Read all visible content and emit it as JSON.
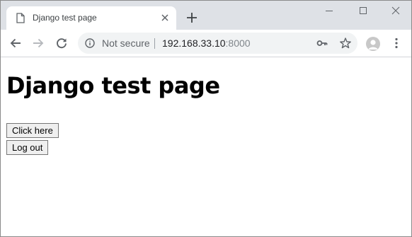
{
  "browser": {
    "tab": {
      "title": "Django test page"
    },
    "omnibox": {
      "security_label": "Not secure",
      "url_host": "192.168.33.10",
      "url_port": ":8000"
    }
  },
  "page": {
    "heading": "Django test page",
    "buttons": {
      "click_here": "Click here",
      "log_out": "Log out"
    }
  },
  "icons": [
    "page-icon",
    "close-icon",
    "plus-icon",
    "minimize-icon",
    "maximize-icon",
    "close-window-icon",
    "back-arrow-icon",
    "forward-arrow-icon",
    "reload-icon",
    "info-icon",
    "key-icon",
    "star-icon",
    "profile-icon",
    "more-vert-icon"
  ]
}
